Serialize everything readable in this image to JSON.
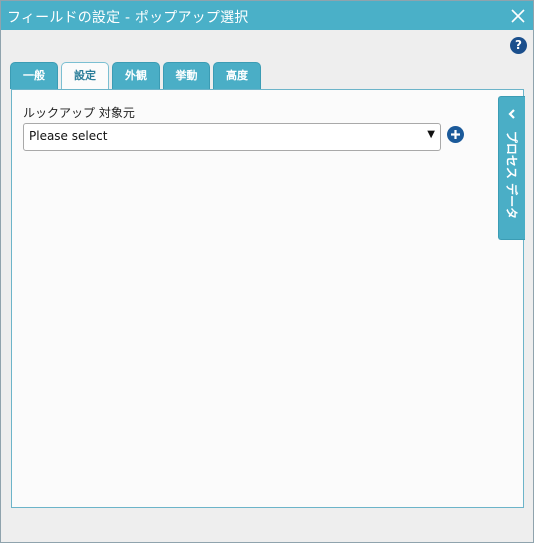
{
  "window": {
    "title": "フィールドの設定 - ポップアップ選択"
  },
  "tabs": [
    {
      "label": "一般",
      "active": false
    },
    {
      "label": "設定",
      "active": true
    },
    {
      "label": "外観",
      "active": false
    },
    {
      "label": "挙動",
      "active": false
    },
    {
      "label": "高度",
      "active": false
    }
  ],
  "settings": {
    "lookup_label": "ルックアップ 対象元",
    "lookup_select": {
      "selected": "Please select"
    }
  },
  "side_panel": {
    "label": "プロセス データ"
  },
  "icons": {
    "close": "close-icon",
    "help": "help-icon",
    "add": "plus-circle-icon",
    "collapse": "chevron-left-icon",
    "select_arrow": "triangle-down-icon"
  },
  "colors": {
    "accent": "#4ab0c8",
    "help_icon": "#1b4f8c",
    "active_tab_text": "#2b7d99"
  }
}
